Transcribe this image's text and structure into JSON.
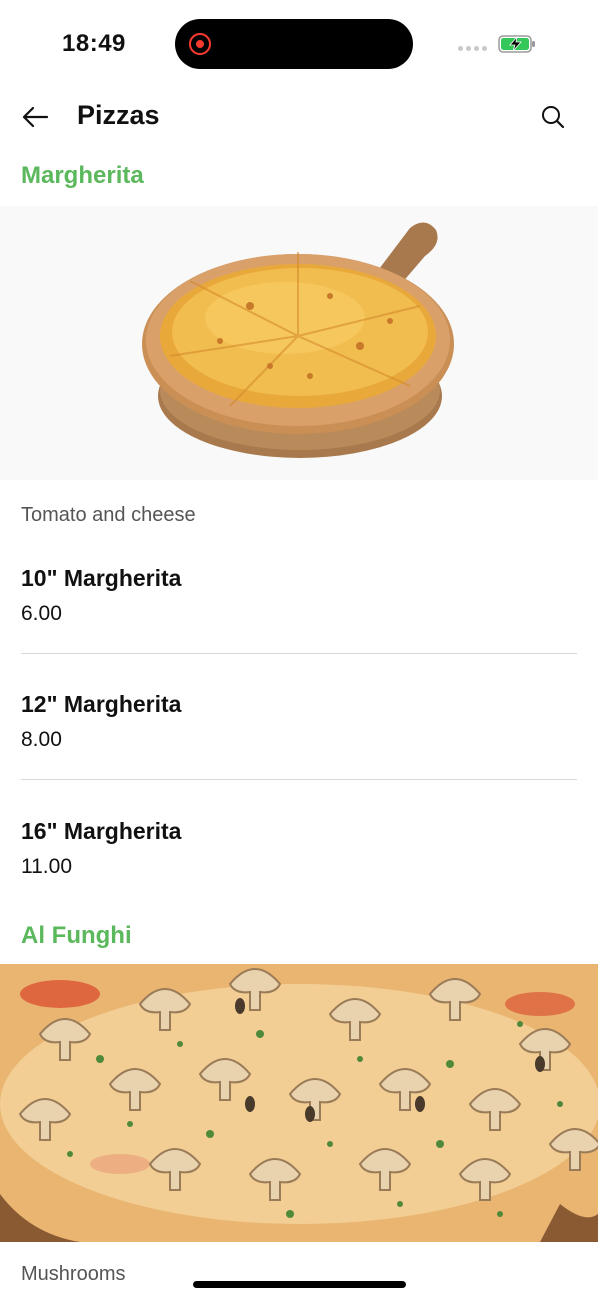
{
  "status_bar": {
    "time": "18:49"
  },
  "app_bar": {
    "title": "Pizzas",
    "back_icon": "arrow-left-icon",
    "search_icon": "search-icon"
  },
  "colors": {
    "accent": "#5cb85c",
    "text": "#111111",
    "muted": "#555555",
    "divider": "#d9d9d9"
  },
  "categories": [
    {
      "name": "Margherita",
      "description": "Tomato and cheese",
      "items": [
        {
          "name": "10\" Margherita",
          "price": "6.00"
        },
        {
          "name": "12\" Margherita",
          "price": "8.00"
        },
        {
          "name": "16\" Margherita",
          "price": "11.00"
        }
      ]
    },
    {
      "name": "Al Funghi",
      "description": "Mushrooms"
    }
  ]
}
